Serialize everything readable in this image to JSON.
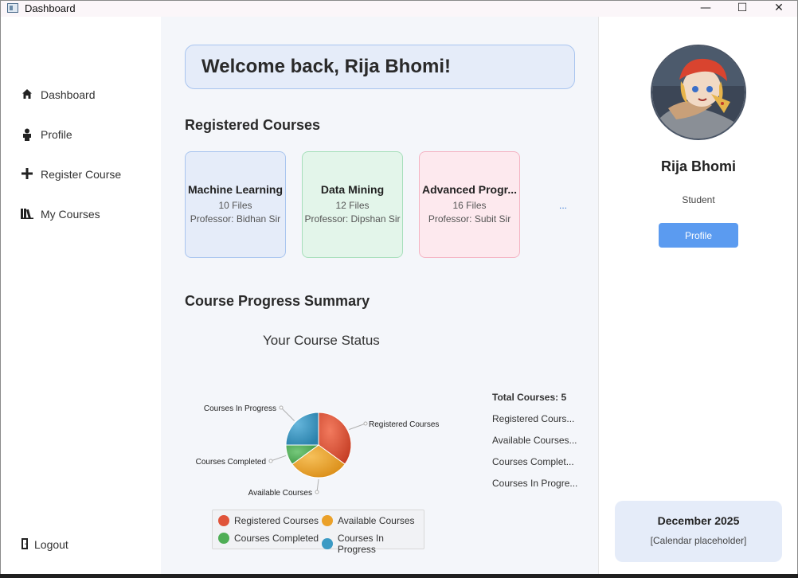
{
  "window": {
    "title": "Dashboard",
    "controls": {
      "minimize": "—",
      "maximize": "☐",
      "close": "✕"
    }
  },
  "sidebar": {
    "items": [
      {
        "label": "Dashboard",
        "icon": "home-icon"
      },
      {
        "label": "Profile",
        "icon": "person-icon"
      },
      {
        "label": "Register Course",
        "icon": "plus-icon"
      },
      {
        "label": "My Courses",
        "icon": "books-icon"
      }
    ],
    "logout": {
      "label": "Logout",
      "icon": "door-icon"
    }
  },
  "main": {
    "welcome": "Welcome back, Rija Bhomi!",
    "registered_title": "Registered Courses",
    "courses": [
      {
        "name": "Machine Learning",
        "files": "10 Files",
        "professor": "Professor: Bidhan Sir",
        "bg": "#e5ecf9",
        "border": "#a9c5ef"
      },
      {
        "name": "Data Mining",
        "files": "12 Files",
        "professor": "Professor: Dipshan Sir",
        "bg": "#e3f5ea",
        "border": "#a7dfbb"
      },
      {
        "name": "Advanced Progr...",
        "files": "16 Files",
        "professor": "Professor: Subit Sir",
        "bg": "#fde9ee",
        "border": "#f4b3c3"
      }
    ],
    "more": "...",
    "progress_title": "Course Progress Summary",
    "summary": {
      "total": "Total Courses: 5",
      "lines": [
        "Registered Cours...",
        "Available Courses...",
        "Courses Complet...",
        "Courses In Progre..."
      ]
    }
  },
  "chart_data": {
    "type": "pie",
    "title": "Your Course Status",
    "slices": [
      {
        "label": "Registered Courses",
        "value": 35,
        "color": "#e0543a"
      },
      {
        "label": "Available Courses",
        "value": 30,
        "color": "#eba12a"
      },
      {
        "label": "Courses Completed",
        "value": 10,
        "color": "#4fae56"
      },
      {
        "label": "Courses In Progress",
        "value": 25,
        "color": "#3b9ac4"
      }
    ],
    "legend": [
      "Registered Courses",
      "Available Courses",
      "Courses Completed",
      "Courses In Progress"
    ],
    "legend_position": "bottom"
  },
  "profile": {
    "name": "Rija Bhomi",
    "role": "Student",
    "button": "Profile"
  },
  "calendar": {
    "month": "December 2025",
    "placeholder": "[Calendar placeholder]"
  }
}
